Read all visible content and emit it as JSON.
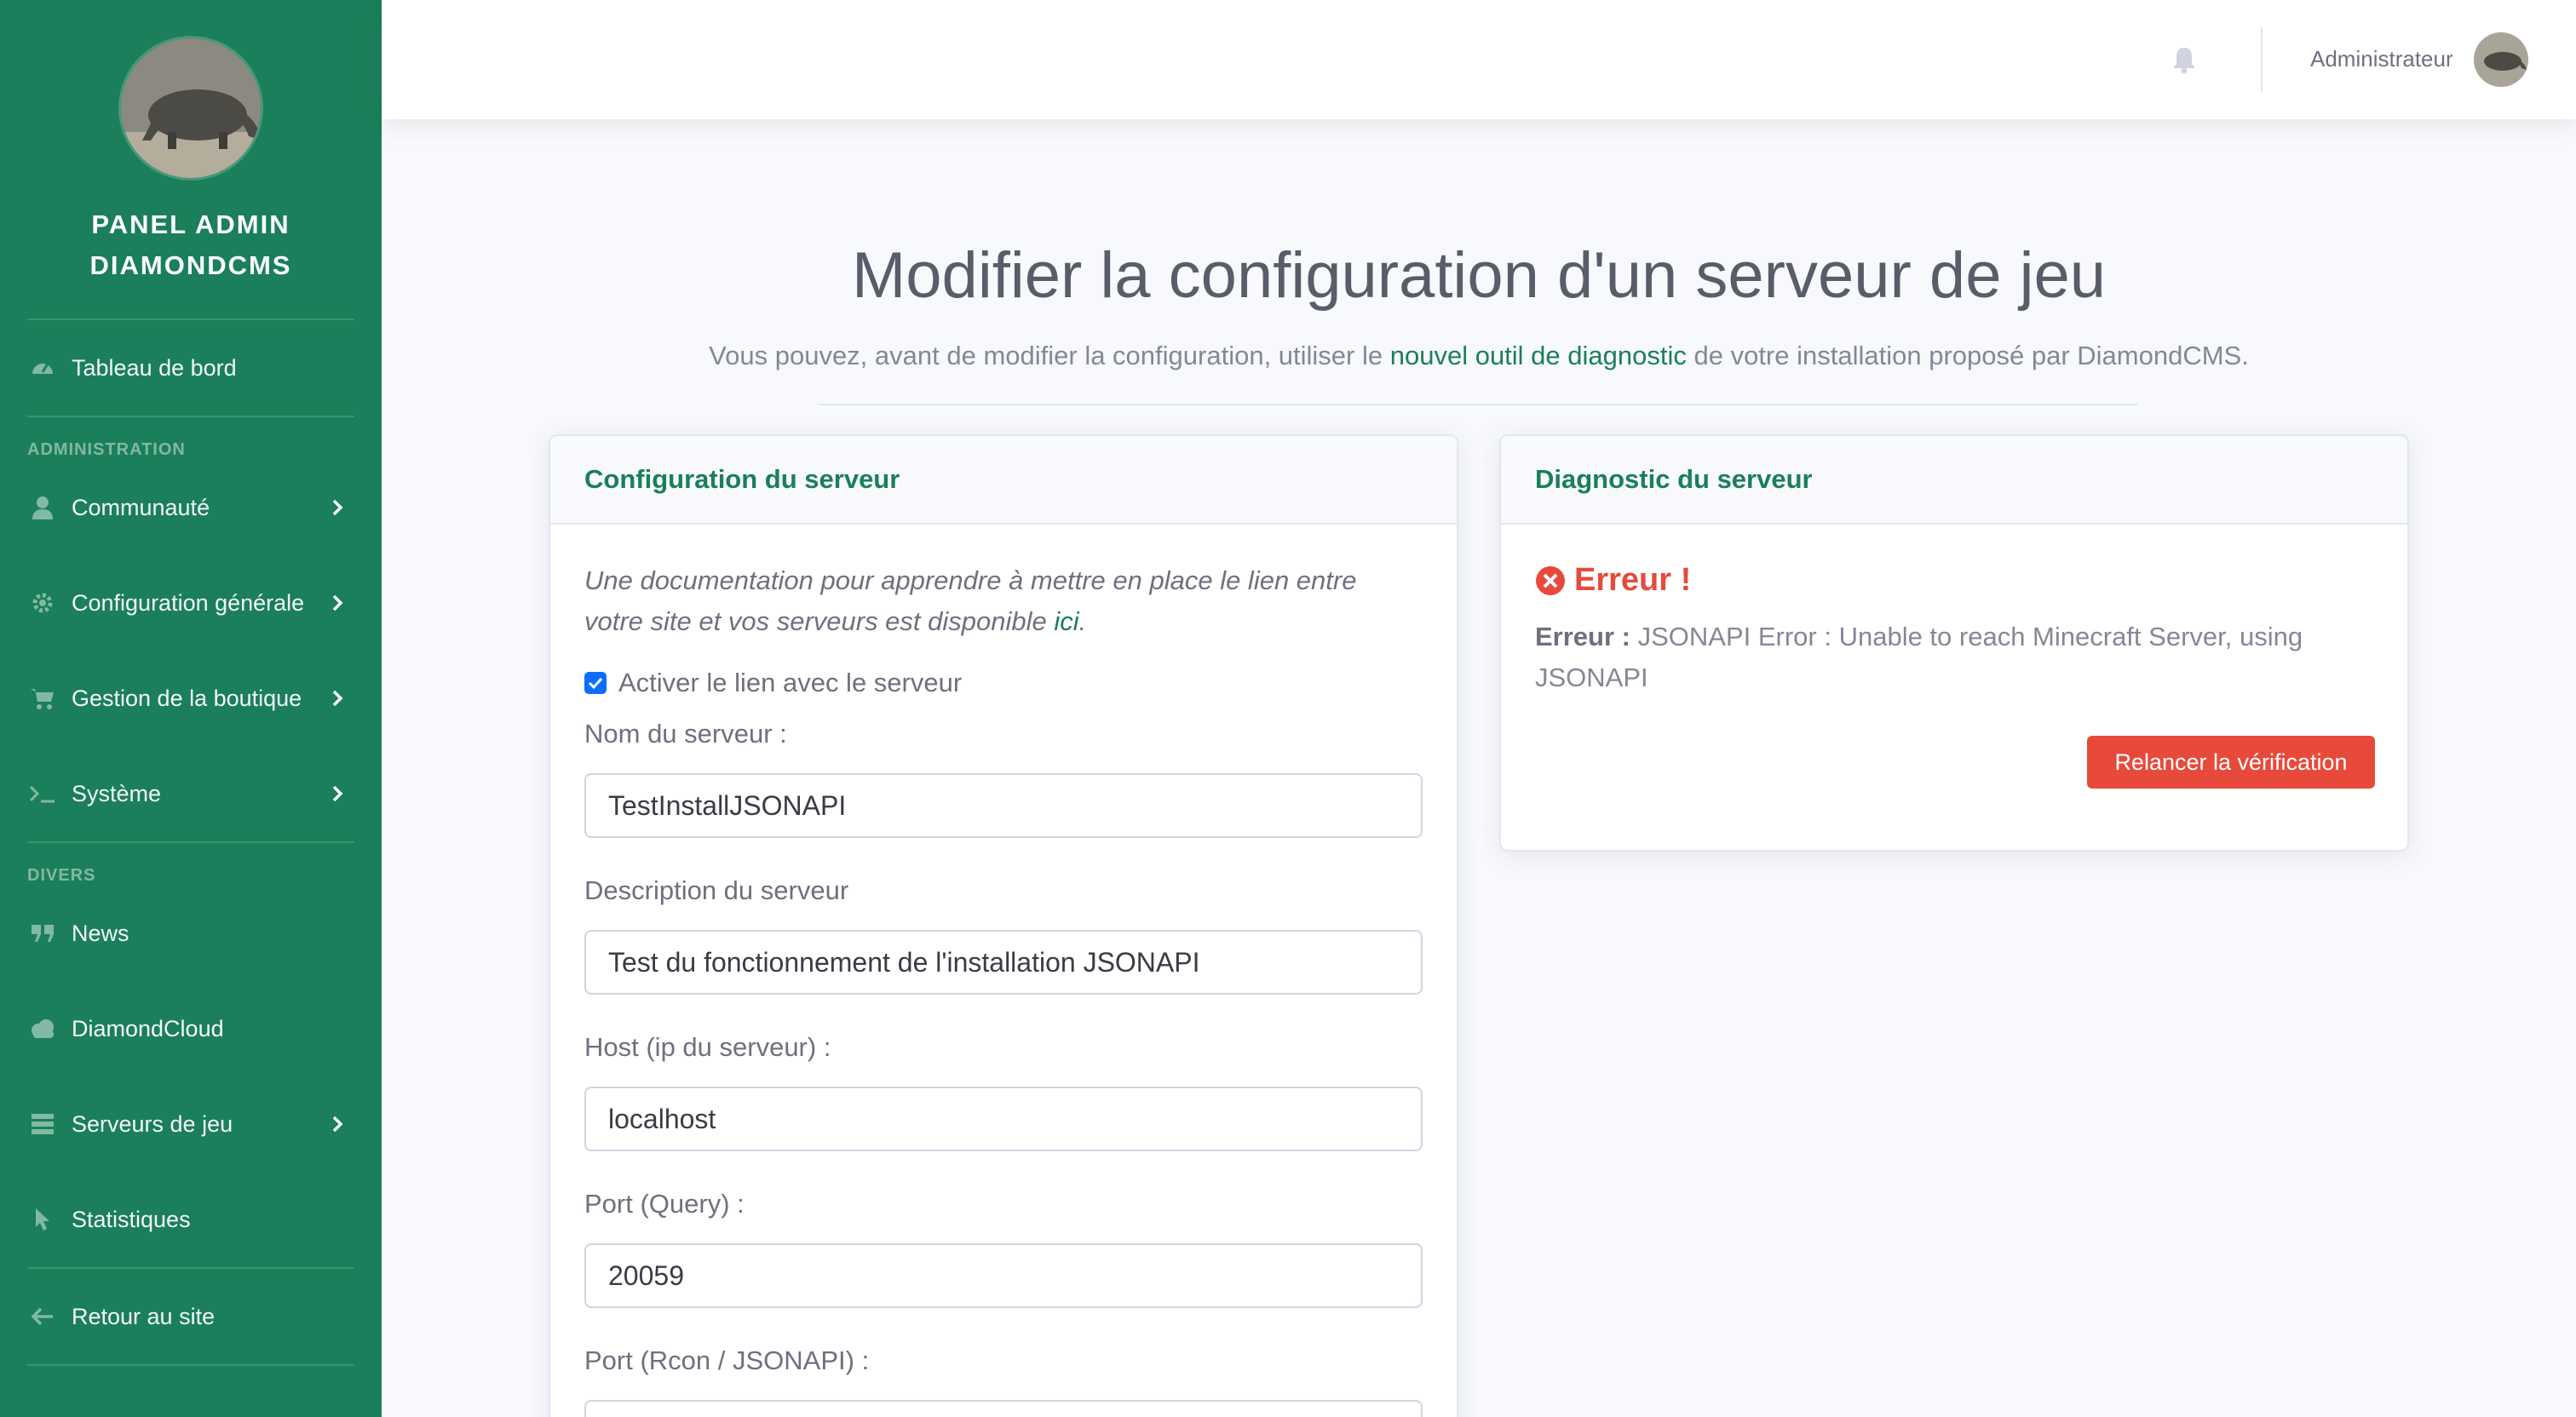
{
  "sidebar": {
    "brand_line1": "PANEL ADMIN",
    "brand_line2": "DIAMONDCMS",
    "dashboard": "Tableau de bord",
    "section_admin": "ADMINISTRATION",
    "community": "Communauté",
    "general_config": "Configuration générale",
    "shop": "Gestion de la boutique",
    "system": "Système",
    "section_misc": "DIVERS",
    "news": "News",
    "cloud": "DiamondCloud",
    "game_servers": "Serveurs de jeu",
    "stats": "Statistiques",
    "back": "Retour au site"
  },
  "topbar": {
    "username": "Administrateur"
  },
  "page": {
    "title": "Modifier la configuration d'un serveur de jeu",
    "subtitle_before": "Vous pouvez, avant de modifier la configuration, utiliser le ",
    "subtitle_link": "nouvel outil de diagnostic",
    "subtitle_after": " de votre installation proposé par DiamondCMS."
  },
  "config_card": {
    "title": "Configuration du serveur",
    "doc_text": "Une documentation pour apprendre à mettre en place le lien entre votre site et vos serveurs est disponible ",
    "doc_link": "ici",
    "doc_end": ".",
    "enable_link_label": "Activer le lien avec le serveur",
    "enable_link_checked": true,
    "name_label": "Nom du serveur :",
    "name_value": "TestInstallJSONAPI",
    "desc_label": "Description du serveur",
    "desc_value": "Test du fonctionnement de l'installation JSONAPI",
    "host_label": "Host (ip du serveur) :",
    "host_value": "localhost",
    "port_query_label": "Port (Query) :",
    "port_query_value": "20059",
    "port_rcon_label": "Port (Rcon / JSONAPI) :",
    "port_rcon_value": ""
  },
  "diag_card": {
    "title": "Diagnostic du serveur",
    "error_title": "Erreur !",
    "error_label": "Erreur :",
    "error_message": " JSONAPI Error : Unable to reach Minecraft Server, using JSONAPI",
    "retry_button": "Relancer la vérification"
  },
  "colors": {
    "primary": "#1a7f5a",
    "danger": "#e74a3b",
    "checkbox": "#0d6efd"
  }
}
